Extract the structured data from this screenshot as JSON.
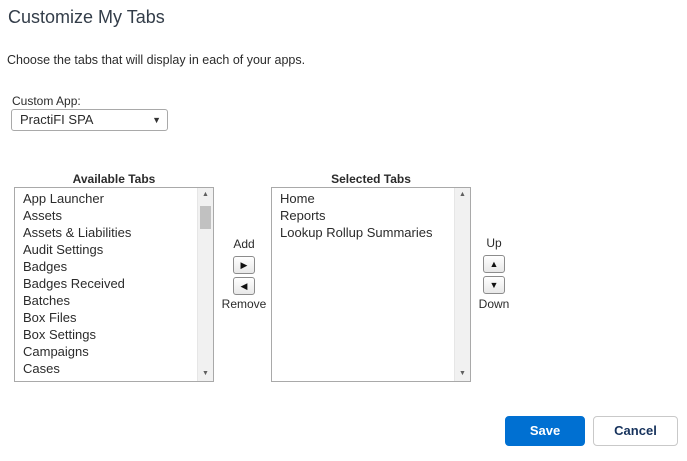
{
  "page": {
    "title": "Customize My Tabs",
    "description": "Choose the tabs that will display in each of your apps."
  },
  "custom_app": {
    "label": "Custom App:",
    "selected": "PractiFI SPA"
  },
  "available_tabs": {
    "heading": "Available Tabs",
    "items": [
      "App Launcher",
      "Assets",
      "Assets & Liabilities",
      "Audit Settings",
      "Badges",
      "Badges Received",
      "Batches",
      "Box Files",
      "Box Settings",
      "Campaigns",
      "Cases"
    ]
  },
  "selected_tabs": {
    "heading": "Selected Tabs",
    "items": [
      "Home",
      "Reports",
      "Lookup Rollup Summaries"
    ]
  },
  "move_controls": {
    "add_label": "Add",
    "remove_label": "Remove",
    "add_glyph": "▶",
    "remove_glyph": "◀"
  },
  "order_controls": {
    "up_label": "Up",
    "down_label": "Down",
    "up_glyph": "▲",
    "down_glyph": "▼"
  },
  "actions": {
    "save_label": "Save",
    "cancel_label": "Cancel"
  },
  "colors": {
    "primary_button": "#0070d2",
    "title_text": "#333d49"
  },
  "icons": {
    "dropdown": "chevron-down-icon",
    "add": "arrow-right-icon",
    "remove": "arrow-left-icon",
    "up": "arrow-up-icon",
    "down": "arrow-down-icon"
  }
}
